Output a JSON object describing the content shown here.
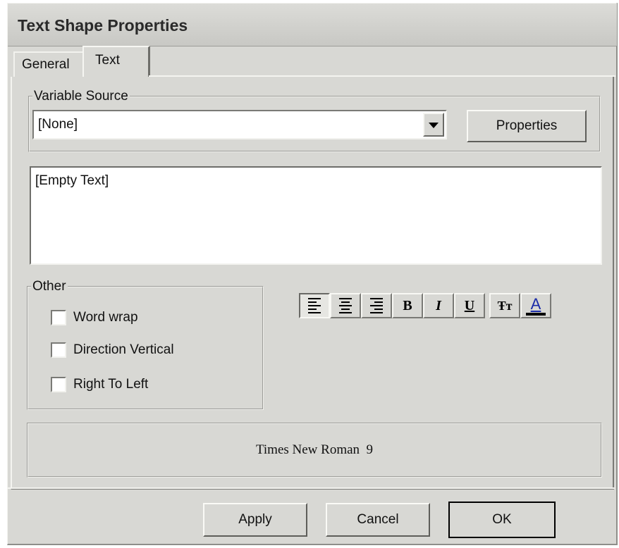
{
  "dialog": {
    "title": "Text Shape Properties"
  },
  "tabs": [
    {
      "label": "General",
      "active": false
    },
    {
      "label": "Text",
      "active": true
    }
  ],
  "variable_source": {
    "legend": "Variable Source",
    "selected": "[None]",
    "properties_button": "Properties"
  },
  "text_area": {
    "value": "[Empty Text]"
  },
  "other": {
    "legend": "Other",
    "options": [
      {
        "label": "Word wrap",
        "checked": false
      },
      {
        "label": "Direction Vertical",
        "checked": false
      },
      {
        "label": "Right To Left",
        "checked": false
      }
    ]
  },
  "format_toolbar": {
    "buttons": [
      {
        "icon": "align-left-icon",
        "pressed": true
      },
      {
        "icon": "align-center-icon",
        "pressed": false
      },
      {
        "icon": "align-right-icon",
        "pressed": false
      },
      {
        "icon": "bold-icon",
        "glyph": "B"
      },
      {
        "icon": "italic-icon",
        "glyph": "I"
      },
      {
        "icon": "underline-icon",
        "glyph": "U"
      },
      {
        "icon": "font-icon",
        "glyph": "Ŧт"
      },
      {
        "icon": "font-color-icon",
        "glyph": "A",
        "color": "#1a2aa8"
      }
    ]
  },
  "font_display": "Times New Roman  9",
  "footer": {
    "apply": "Apply",
    "cancel": "Cancel",
    "ok": "OK"
  },
  "colors": {
    "dialog_bg": "#d8d8d4",
    "font_color_accent": "#1a2aa8"
  }
}
